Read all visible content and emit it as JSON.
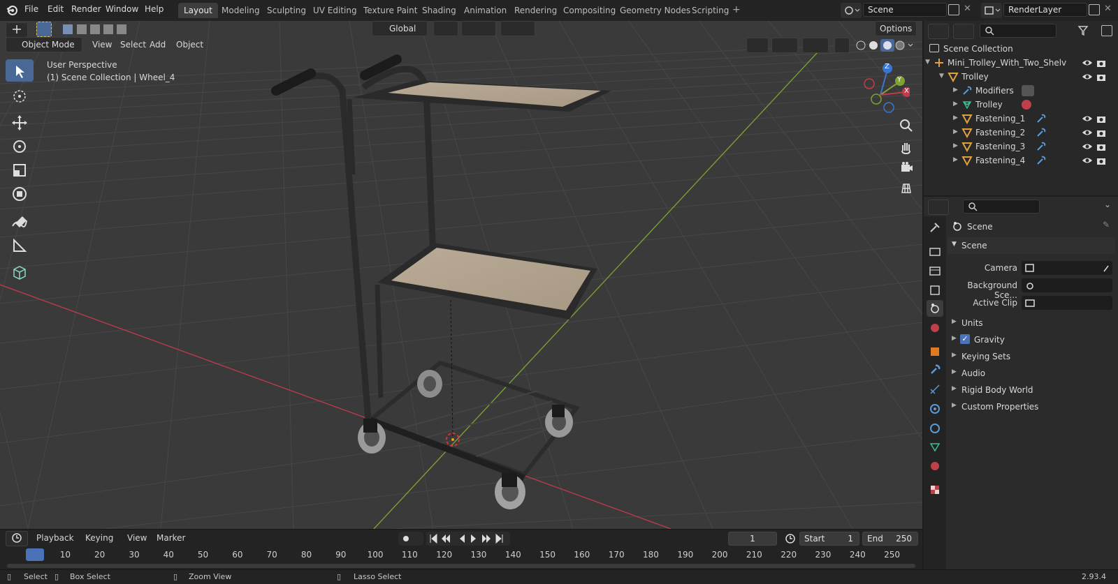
{
  "topbar": {
    "menus": [
      "File",
      "Edit",
      "Render",
      "Window",
      "Help"
    ],
    "workspaces": [
      "Layout",
      "Modeling",
      "Sculpting",
      "UV Editing",
      "Texture Paint",
      "Shading",
      "Animation",
      "Rendering",
      "Compositing",
      "Geometry Nodes",
      "Scripting"
    ],
    "active_workspace": "Layout",
    "scene_name": "Scene",
    "view_layer": "RenderLayer"
  },
  "viewport": {
    "mode": "Object Mode",
    "header_menus": [
      "View",
      "Select",
      "Add",
      "Object"
    ],
    "transform_orientation": "Global",
    "options_label": "Options",
    "overlay_title": "User Perspective",
    "overlay_subtitle": "(1) Scene Collection | Wheel_4",
    "gizmo": {
      "z": "Z",
      "y": "Y",
      "x": "X"
    }
  },
  "outliner": {
    "scene_collection": "Scene Collection",
    "rows": [
      {
        "label": "Mini_Trolley_With_Two_Shelv",
        "icon": "empty-icon"
      },
      {
        "label": "Trolley",
        "icon": "mesh-object-icon"
      },
      {
        "label": "Modifiers",
        "icon": "wrench-icon"
      },
      {
        "label": "Trolley",
        "icon": "mesh-data-icon"
      },
      {
        "label": "Fastening_1",
        "icon": "mesh-object-icon"
      },
      {
        "label": "Fastening_2",
        "icon": "mesh-object-icon"
      },
      {
        "label": "Fastening_3",
        "icon": "mesh-object-icon"
      },
      {
        "label": "Fastening_4",
        "icon": "mesh-object-icon"
      }
    ]
  },
  "properties": {
    "context": "Scene",
    "panel_title": "Scene",
    "fields": [
      {
        "label": "Camera",
        "value": ""
      },
      {
        "label": "Background Sce...",
        "value": ""
      },
      {
        "label": "Active Clip",
        "value": ""
      }
    ],
    "collapsed_panels": [
      "Units",
      "Gravity",
      "Keying Sets",
      "Audio",
      "Rigid Body World",
      "Custom Properties"
    ],
    "gravity_checked": true
  },
  "timeline": {
    "menus": [
      "Playback",
      "Keying",
      "View",
      "Marker"
    ],
    "current_frame": "1",
    "start_label": "Start",
    "start": "1",
    "end_label": "End",
    "end": "250",
    "ticks": [
      "1",
      "10",
      "20",
      "30",
      "40",
      "50",
      "60",
      "70",
      "80",
      "90",
      "100",
      "110",
      "120",
      "130",
      "140",
      "150",
      "160",
      "170",
      "180",
      "190",
      "200",
      "210",
      "220",
      "230",
      "240",
      "250"
    ]
  },
  "statusbar": {
    "items": [
      "Select",
      "Box Select",
      "Zoom View",
      "Lasso Select"
    ],
    "version": "2.93.4"
  },
  "colors": {
    "accent": "#4a6896",
    "x_axis": "#c43a4a",
    "y_axis": "#7ea334",
    "z_axis": "#3b75d4"
  }
}
